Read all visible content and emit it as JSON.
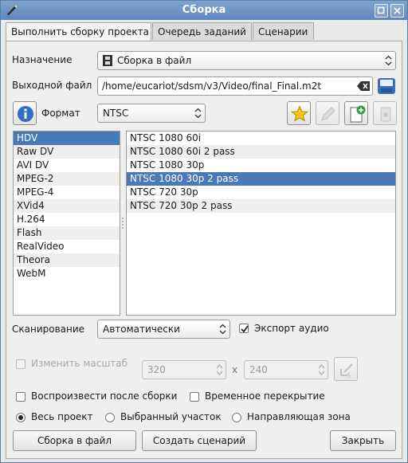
{
  "window": {
    "title": "Сборка"
  },
  "tabs": [
    "Выполнить сборку проекта",
    "Очередь заданий",
    "Сценарии"
  ],
  "destination": {
    "label": "Назначение",
    "value": "Сборка в файл"
  },
  "output": {
    "label": "Выходной файл",
    "value": "/home/eucariot/sdsm/v3/Video/final_Final.m2t"
  },
  "format": {
    "label": "Формат",
    "value": "NTSC"
  },
  "categories": {
    "items": [
      "HDV",
      "Raw DV",
      "AVI DV",
      "MPEG-2",
      "MPEG-4",
      "XVid4",
      "H.264",
      "Flash",
      "RealVideo",
      "Theora",
      "WebM"
    ],
    "selected": "HDV"
  },
  "presets": {
    "items": [
      "NTSC 1080 60i",
      "NTSC 1080 60i 2 pass",
      "NTSC 1080 30p",
      "NTSC 1080 30p 2 pass",
      "NTSC 720 30p",
      "NTSC 720 30p 2 pass"
    ],
    "selected": "NTSC 1080 30p 2 pass"
  },
  "scan": {
    "label": "Сканирование",
    "value": "Автоматически"
  },
  "export_audio": {
    "label": "Экспорт аудио",
    "checked": true
  },
  "rescale": {
    "label": "Изменить масштаб",
    "width": "320",
    "separator": "x",
    "height": "240",
    "checked": false
  },
  "play_after": {
    "label": "Воспроизвести после сборки",
    "checked": false
  },
  "overlay": {
    "label": "Временное перекрытие",
    "checked": false
  },
  "zones": {
    "options": [
      "Весь проект",
      "Выбранный участок",
      "Направляющая зона"
    ],
    "selected": "Весь проект"
  },
  "buttons": {
    "render": "Сборка в файл",
    "script": "Создать сценарий",
    "close": "Закрыть"
  },
  "colors": {
    "titlebar": "#6a8fc2",
    "selection": "#4a79b8"
  },
  "icons": [
    "app-icon",
    "maximize-icon",
    "close-icon",
    "clear-icon",
    "save-icon",
    "info-icon",
    "star-icon",
    "edit-icon",
    "add-profile-icon",
    "delete-profile-icon",
    "scale-icon"
  ]
}
